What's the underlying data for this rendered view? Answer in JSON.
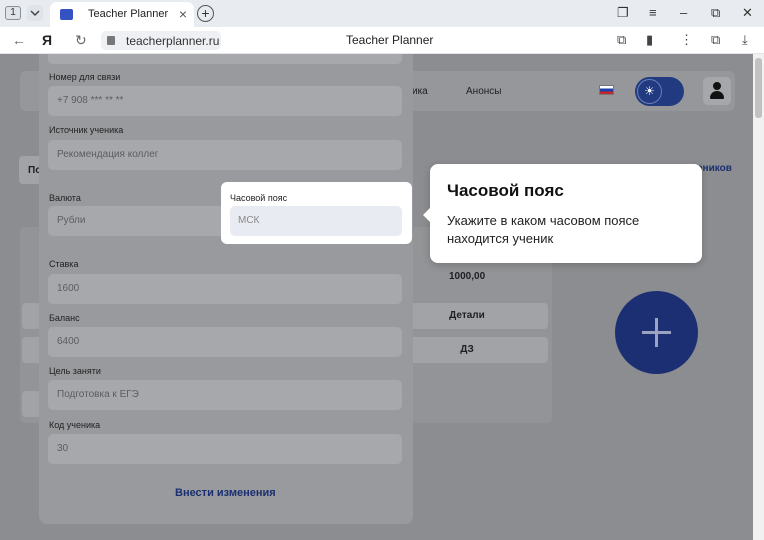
{
  "browser": {
    "tab_count": "1",
    "tab_title": "Teacher Planner",
    "url": "teacherplanner.ru",
    "page_title": "Teacher Planner"
  },
  "header": {
    "nav_partial": "ика",
    "nav_announcements": "Анонсы",
    "theme_toggle_icon": "sun-icon"
  },
  "background": {
    "tab_partial": "По",
    "students_link_partial": "еников",
    "amount": "1000,00",
    "details_button": "Детали",
    "homework_button": "ДЗ"
  },
  "form": {
    "phone_label": "Номер для связи",
    "phone_value": "+7 908 *** ** **",
    "source_label": "Источник ученика",
    "source_value": "Рекомендация коллег",
    "currency_label": "Валюта",
    "currency_value": "Рубли",
    "timezone_label": "Часовой пояс",
    "timezone_value": "МСК",
    "rate_label": "Ставка",
    "rate_value": "1600",
    "balance_label": "Баланс",
    "balance_value": "6400",
    "goal_label": "Цель заняти",
    "goal_value": "Подготовка к ЕГЭ",
    "code_label": "Код ученика",
    "code_value": "30",
    "submit_label": "Внести изменения"
  },
  "tooltip": {
    "title": "Часовой пояс",
    "text": "Укажите в каком часовом поясе находится ученик"
  }
}
